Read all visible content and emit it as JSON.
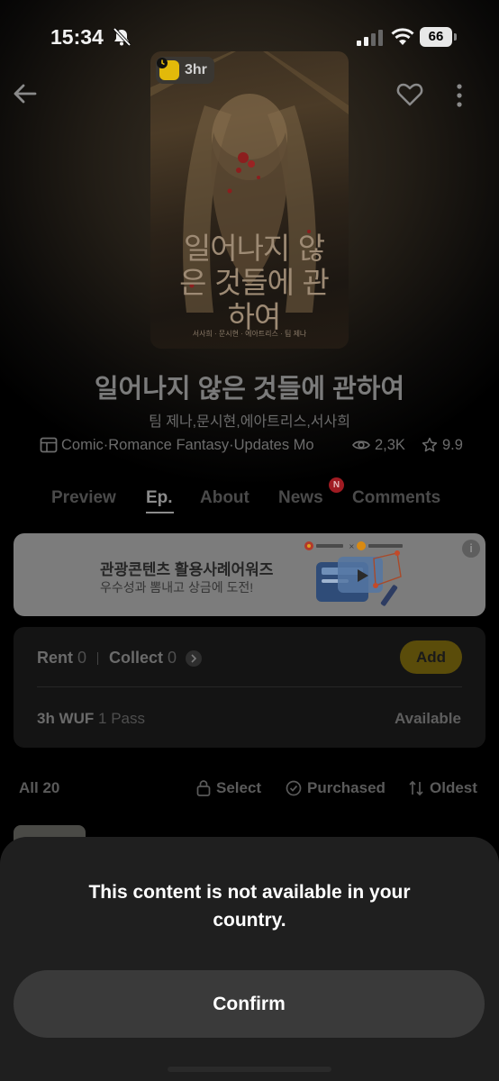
{
  "status_bar": {
    "time": "15:34",
    "battery": "66"
  },
  "cover": {
    "badge": "3hr",
    "title_art": "일어나지 않은 것들에 관하여",
    "credit": "서사희 · 문시현 · 에아트리스 · 팀 제나"
  },
  "work": {
    "title": "일어나지 않은 것들에 관하여",
    "authors": "팀 제나,문시현,에아트리스,서사희",
    "genre": "Comic·Romance Fantasy·Updates Mo",
    "views": "2,3K",
    "rating": "9.9"
  },
  "tabs": [
    {
      "label": "Preview",
      "active": false
    },
    {
      "label": "Ep.",
      "active": true
    },
    {
      "label": "About",
      "active": false
    },
    {
      "label": "News",
      "active": false
    },
    {
      "label": "Comments",
      "active": false
    }
  ],
  "news_badge": "N",
  "banner": {
    "title": "관광콘텐츠 활용사례어워즈",
    "subtitle": "우수성과 뽐내고 상금에 도전!",
    "info": "i"
  },
  "rental": {
    "rent_label": "Rent",
    "rent_count": "0",
    "collect_label": "Collect",
    "collect_count": "0",
    "add_label": "Add",
    "pass_label": "3h WUF",
    "pass_count": "1 Pass",
    "pass_status": "Available"
  },
  "list": {
    "all_label": "All 20",
    "select_label": "Select",
    "purchased_label": "Purchased",
    "sort_label": "Oldest"
  },
  "modal": {
    "message": "This content is not available in your country.",
    "confirm_label": "Confirm"
  },
  "colors": {
    "accent": "#e2b90a",
    "badge_red": "#a01b22",
    "sheet": "#1f1f1f"
  }
}
